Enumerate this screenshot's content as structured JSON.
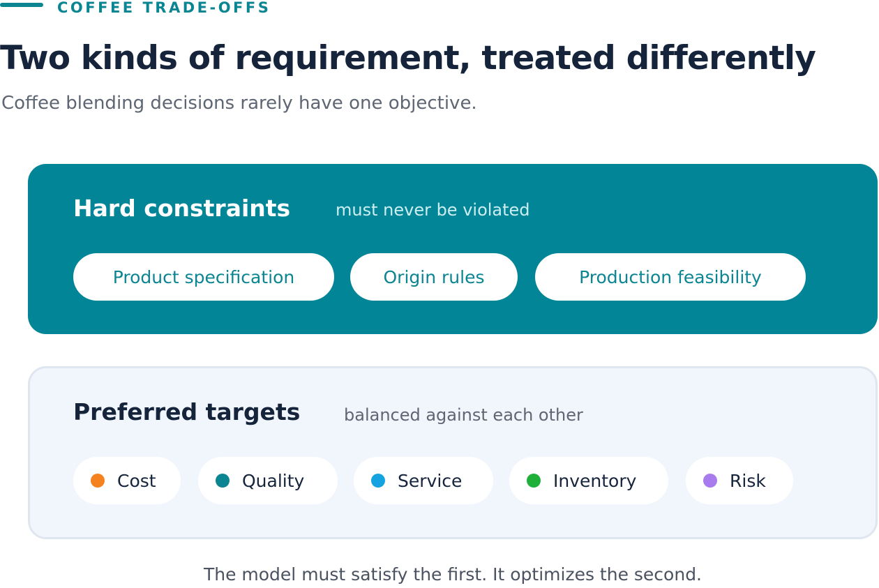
{
  "eyebrow": "COFFEE TRADE-OFFS",
  "title": "Two kinds of requirement, treated differently",
  "subtitle": "Coffee blending decisions rarely have one objective.",
  "hard": {
    "heading": "Hard constraints",
    "note": "must never be violated",
    "items": [
      {
        "label": "Product specification"
      },
      {
        "label": "Origin rules"
      },
      {
        "label": "Production feasibility"
      }
    ]
  },
  "preferred": {
    "heading": "Preferred targets",
    "note": "balanced against each other",
    "items": [
      {
        "label": "Cost",
        "color": "#f4831f"
      },
      {
        "label": "Quality",
        "color": "#0c8592"
      },
      {
        "label": "Service",
        "color": "#15a2e0"
      },
      {
        "label": "Inventory",
        "color": "#1fb03a"
      },
      {
        "label": "Risk",
        "color": "#a87bef"
      }
    ]
  },
  "footer": "The model must satisfy the first. It optimizes the second.",
  "colors": {
    "accent": "#0c8592",
    "hard_panel": "#028596",
    "preferred_panel": "#f1f6fd",
    "heading_text": "#16243b"
  }
}
